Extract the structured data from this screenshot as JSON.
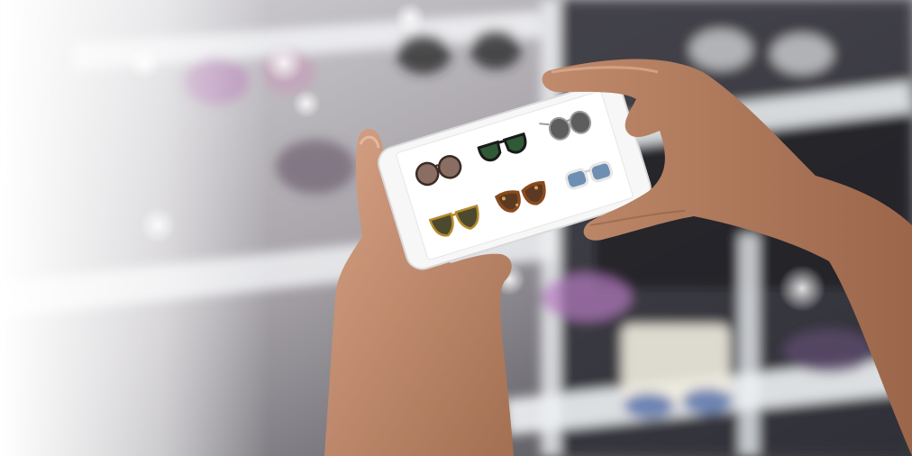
{
  "scene": {
    "description_type": "photo",
    "colors": {
      "shelf_white": "#eef0f2",
      "store_dark": "#2a2b30",
      "skin": "#c89273",
      "skin_shadow": "#9c6a50",
      "phone_body": "#f7f7f7",
      "screen_bg": "#ffffff",
      "left_fade": "#ffffff"
    }
  },
  "phone_screen": {
    "products": [
      {
        "icon": "round-sunglasses-icon",
        "frame": "#3b2b25",
        "lens": "#8a6e63"
      },
      {
        "icon": "clubmaster-sunglasses-icon",
        "frame": "#1a1a1a",
        "lens": "#2f5a35"
      },
      {
        "icon": "aviator-sunglasses-icon",
        "frame": "#9a9a9a",
        "lens": "#5d5d5d"
      },
      {
        "icon": "gold-aviator-sunglasses-icon",
        "frame": "#b88a2b",
        "lens": "#4c4a2e"
      },
      {
        "icon": "tortoise-cat-eye-sunglasses-icon",
        "frame": "#8a4a1c",
        "lens": "#5a3a22"
      },
      {
        "icon": "clear-frame-blue-lens-sunglasses-icon",
        "frame": "#e6e6e6",
        "lens": "#6f8fb2"
      }
    ]
  }
}
